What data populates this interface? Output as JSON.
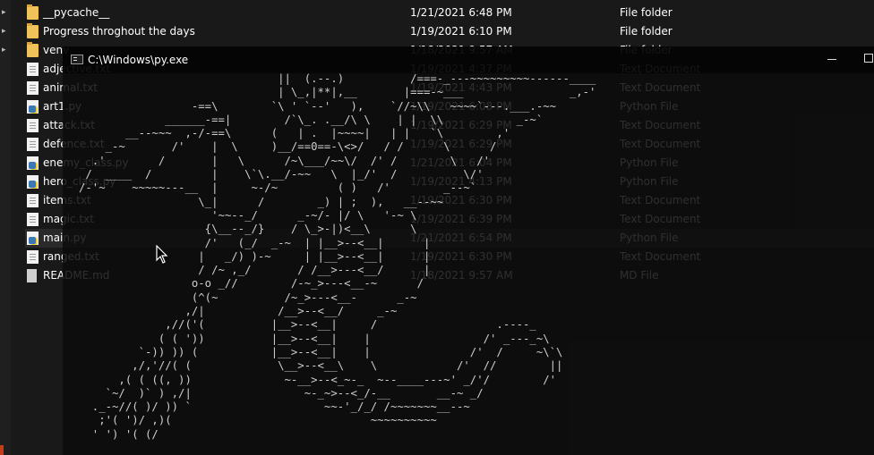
{
  "explorer": {
    "files": [
      {
        "name": "__pycache__",
        "date": "1/21/2021 6:48 PM",
        "type": "File folder",
        "icon": "folder-icon"
      },
      {
        "name": "Progress throghout the days",
        "date": "1/19/2021 6:10 PM",
        "type": "File folder",
        "icon": "folder-icon"
      },
      {
        "name": "venv",
        "date": "1/18/2021 9:57 AM",
        "type": "File folder",
        "icon": "folder-icon"
      },
      {
        "name": "adjective.txt",
        "date": "1/19/2021 4:37 PM",
        "type": "Text Document",
        "icon": "text-file-icon"
      },
      {
        "name": "animal.txt",
        "date": "1/19/2021 4:43 PM",
        "type": "Text Document",
        "icon": "text-file-icon"
      },
      {
        "name": "art1.py",
        "date": "1/19/2021 6:08 PM",
        "type": "Python File",
        "icon": "python-file-icon"
      },
      {
        "name": "attack.txt",
        "date": "1/19/2021 6:29 PM",
        "type": "Text Document",
        "icon": "text-file-icon"
      },
      {
        "name": "defence.txt",
        "date": "1/19/2021 6:29 PM",
        "type": "Text Document",
        "icon": "text-file-icon"
      },
      {
        "name": "enemy_class.py",
        "date": "1/21/2021 6:04 PM",
        "type": "Python File",
        "icon": "python-file-icon"
      },
      {
        "name": "hero_class.py",
        "date": "1/19/2021 4:13 PM",
        "type": "Python File",
        "icon": "python-file-icon"
      },
      {
        "name": "items.txt",
        "date": "1/19/2021 6:30 PM",
        "type": "Text Document",
        "icon": "text-file-icon"
      },
      {
        "name": "magic.txt",
        "date": "1/19/2021 6:39 PM",
        "type": "Text Document",
        "icon": "text-file-icon"
      },
      {
        "name": "main.py",
        "date": "1/21/2021 6:54 PM",
        "type": "Python File",
        "icon": "python-file-icon"
      },
      {
        "name": "ranged.txt",
        "date": "1/19/2021 6:30 PM",
        "type": "Text Document",
        "icon": "text-file-icon"
      },
      {
        "name": "README.md",
        "date": "1/18/2021 9:57 AM",
        "type": "MD File",
        "icon": "markdown-file-icon"
      }
    ]
  },
  "console": {
    "title": "C:\\Windows\\py.exe",
    "art": "                              ||  (.--.)          /===-_---~~~~~~~~~------____\n                              | \\_,|**|,__       |===-~___                _,-'\n                 -==\\        `\\ ' `--'   ),    `//~\\\\   ~~~~`---.___.-~~\n             ______-==|        /`\\_. .__/\\ \\    | |  \\\\           _-~`\n       __--~~~  ,-/-==\\      (   | .  |~~~~|   | |   `\\        ,'\n    _-~       /'    |  \\     )__/==0==-\\<>/   / /      \\      /\n  .'        /       |   \\      /~\\___/~~\\/  /' /        \\   /'\n /  ____  /         |    \\`\\.__/-~~   \\  |_/'  /          \\/'\n/-'~    ~~~~~---__  |     ~-/~         ( )   /'        _--~`\n                  \\_|      /        _) | ;  ),   __--~~\n                    '~~--_/      _-~/- |/ \\   '-~ \\\n                   {\\__--_/}    / \\_>-|)<__\\      \\\n                   /'   (_/  _-~  | |__>--<__|      |\n                  |   _/) )-~     | |__>--<__|      |\n                  / /~ ,_/       / /__>---<__/      |\n                 o-o _//        /-~_>---<__-~      /\n                 (^(~          /~_>---<__-      _-~\n                ,/|           /__>--<__/     _-~\n             ,//('(          |__>--<__|     /                  .----_\n            ( ( '))          |__>--<__|    |                 /' _---_~\\\n         `-)) )) (           |__>--<__|    |               /'  /     ~\\`\\\n        ,/,'//( (             \\__>--<__\\    \\            /'  //        ||\n      ,( ( ((, ))              ~-__>--<_~-_  ~--____---~' _/'/        /'\n    `~/  )` ) ,/|                 ~-_~>--<_/-__       __-~ _/\n  ._-~//( )/ )) `                    ~~-'_/_/ /~~~~~~~__--~\n   ;'( ')/ ,)(                              ~~~~~~~~~~\n  ' ') '( (/"
  },
  "colors": {
    "background": "#191919",
    "console_bg": "#0c0c0c",
    "text": "#ffffff",
    "console_text": "#cfcfcf",
    "folder": "#f0c35a",
    "selected_row": "#2a2a2a"
  }
}
